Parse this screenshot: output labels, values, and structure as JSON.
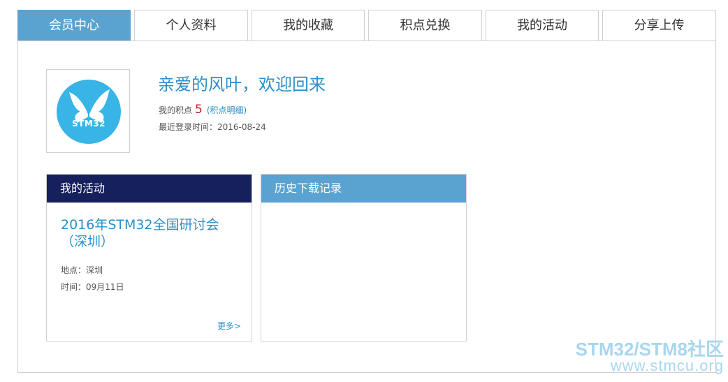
{
  "tabs": [
    {
      "label": "会员中心",
      "active": true
    },
    {
      "label": "个人资料",
      "active": false
    },
    {
      "label": "我的收藏",
      "active": false
    },
    {
      "label": "积点兑换",
      "active": false
    },
    {
      "label": "我的活动",
      "active": false
    },
    {
      "label": "分享上传",
      "active": false
    }
  ],
  "profile": {
    "avatar_text": "STM32",
    "welcome": "亲爱的风叶，欢迎回来",
    "points_label": "我的积点",
    "points_value": "5",
    "points_link": "(积点明细)",
    "last_login": "最近登录时间：2016-08-24"
  },
  "activity_card": {
    "title": "我的活动",
    "event_title": "2016年STM32全国研讨会（深圳）",
    "place": "地点：深圳",
    "time": "时间：09月11日",
    "more": "更多>"
  },
  "history_card": {
    "title": "历史下载记录"
  },
  "watermark": {
    "line1": "STM32/STM8社区",
    "line2": "www.stmcu.org"
  },
  "colors": {
    "accent": "#5aa3d0",
    "header_dark": "#15205c",
    "link": "#2a8fc9",
    "points": "#c02121"
  }
}
